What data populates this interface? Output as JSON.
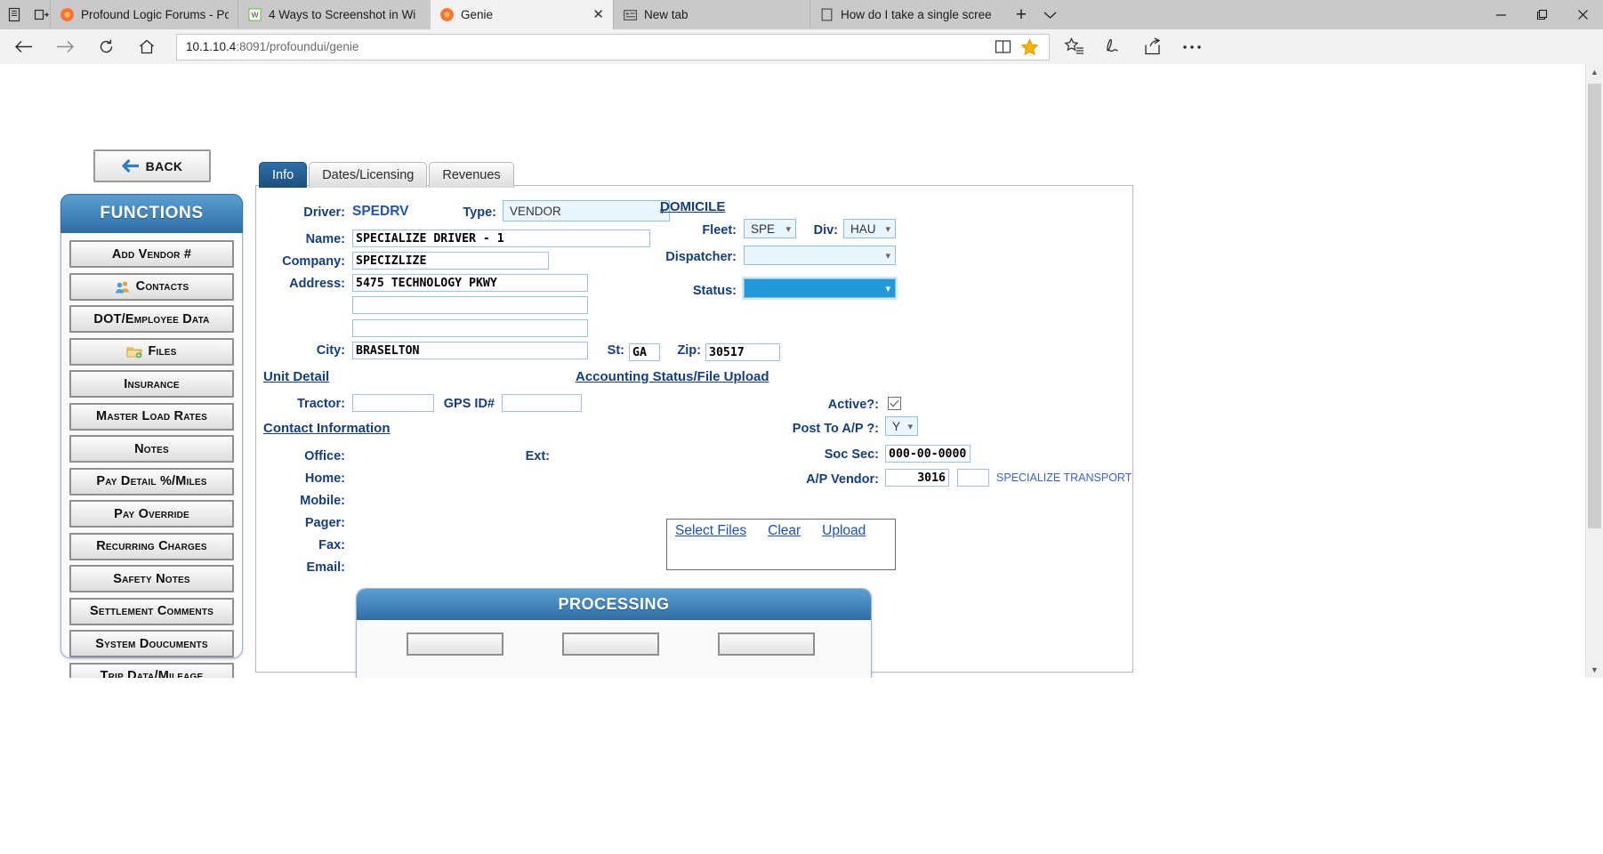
{
  "browser": {
    "tabs": [
      {
        "label": "Profound Logic Forums - Pc",
        "icon": "firefox-icon",
        "active": false
      },
      {
        "label": "4 Ways to Screenshot in Wi",
        "icon": "wikihow-icon",
        "active": false
      },
      {
        "label": "Genie",
        "icon": "firefox-icon",
        "active": true
      },
      {
        "label": "New tab",
        "icon": "newtab-icon",
        "active": false
      },
      {
        "label": "How do I take a single scree",
        "icon": "page-icon",
        "active": false
      }
    ],
    "new_tab_label": "+",
    "tab_menu_label": "∨",
    "url_host": "10.1.10.4",
    "url_rest": ":8091/profoundui/genie",
    "window_controls": {
      "minimize": "—",
      "maximize": "❐",
      "close": "✕"
    },
    "nav": {
      "back": "←",
      "forward": "→",
      "reload": "↻",
      "home": "⌂"
    },
    "toolbar_icons": [
      "reading-view-icon",
      "favorites-star-icon",
      "favorites-hub-icon",
      "notes-pen-icon",
      "share-icon",
      "more-ellipsis-icon"
    ]
  },
  "page": {
    "back_button": "BACK",
    "functions_panel": {
      "title": "FUNCTIONS",
      "items": [
        {
          "label": "Add Vendor #",
          "icon": null
        },
        {
          "label": "Contacts",
          "icon": "contacts-icon"
        },
        {
          "label": "DOT/Employee Data",
          "icon": null
        },
        {
          "label": "Files",
          "icon": "folder-icon"
        },
        {
          "label": "Insurance",
          "icon": null
        },
        {
          "label": "Master Load Rates",
          "icon": null
        },
        {
          "label": "Notes",
          "icon": null
        },
        {
          "label": "Pay Detail %/Miles",
          "icon": null
        },
        {
          "label": "Pay Override",
          "icon": null
        },
        {
          "label": "Recurring Charges",
          "icon": null
        },
        {
          "label": "Safety Notes",
          "icon": null
        },
        {
          "label": "Settlement Comments",
          "icon": null
        },
        {
          "label": "System Doucuments",
          "icon": null
        },
        {
          "label": "Trip Data/Mileage",
          "icon": null
        }
      ]
    },
    "tabs": [
      {
        "label": "Info",
        "active": true
      },
      {
        "label": "Dates/Licensing",
        "active": false
      },
      {
        "label": "Revenues",
        "active": false
      }
    ],
    "form": {
      "driver_label": "Driver:",
      "driver_value": "SPEDRV",
      "type_label": "Type:",
      "type_value": "VENDOR",
      "name_label": "Name:",
      "name_value": "SPECIALIZE DRIVER - 1",
      "company_label": "Company:",
      "company_value": "SPECIZLIZE",
      "address_label": "Address:",
      "address_value": "5475 TECHNOLOGY PKWY",
      "address2_value": "",
      "address3_value": "",
      "city_label": "City:",
      "city_value": "BRASELTON",
      "state_label": "St:",
      "state_value": "GA",
      "zip_label": "Zip:",
      "zip_value": "30517"
    },
    "unit_detail": {
      "heading": "Unit Detail",
      "tractor_label": "Tractor:",
      "tractor_value": "",
      "gps_label": "GPS ID#",
      "gps_value": ""
    },
    "contact_information": {
      "heading": "Contact Information",
      "rows": [
        {
          "label": "Office:",
          "value": ""
        },
        {
          "label": "Home:",
          "value": ""
        },
        {
          "label": "Mobile:",
          "value": ""
        },
        {
          "label": "Pager:",
          "value": ""
        },
        {
          "label": "Fax:",
          "value": ""
        },
        {
          "label": "Email:",
          "value": ""
        }
      ],
      "ext_label": "Ext:",
      "ext_value": ""
    },
    "domicile": {
      "heading": "DOMICILE",
      "fleet_label": "Fleet:",
      "fleet_value": "SPE",
      "div_label": "Div:",
      "div_value": "HAU",
      "dispatcher_label": "Dispatcher:",
      "dispatcher_value": "",
      "status_label": "Status:",
      "status_value": ""
    },
    "accounting": {
      "heading": "Accounting Status/File Upload",
      "active_label": "Active?:",
      "active_checked": "✓",
      "post_ap_label": "Post To A/P ?:",
      "post_ap_value": "Y",
      "soc_sec_label": "Soc Sec:",
      "soc_sec_value": "000-00-0000",
      "ap_vendor_label": "A/P Vendor:",
      "ap_vendor_value": "3016",
      "ap_vendor_value2": "",
      "ap_vendor_name": "SPECIALIZE TRANSPORT",
      "upload_links": [
        "Select Files",
        "Clear",
        "Upload"
      ]
    },
    "processing": {
      "title": "PROCESSING",
      "buttons": [
        "",
        "",
        ""
      ]
    }
  },
  "colors": {
    "accent_blue": "#2f6ea6",
    "label_blue": "#153f7a",
    "link_blue": "#1b4fbe",
    "focus_blue": "#1f9ad6",
    "star_yellow": "#f5b400"
  }
}
